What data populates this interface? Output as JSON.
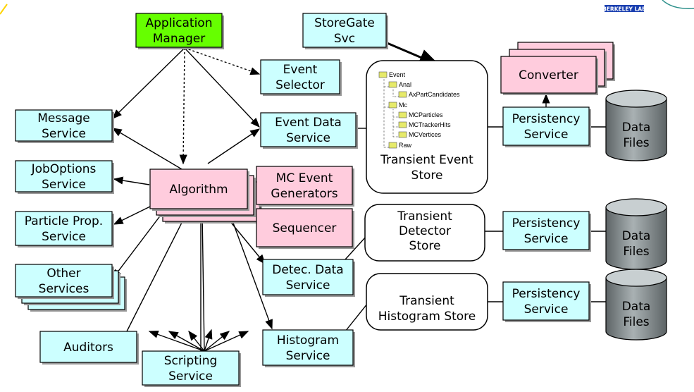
{
  "logo": {
    "text": "BERKELEY LAB",
    "color": "#1a3fb0"
  },
  "colors": {
    "service": "#ccffff",
    "component": "#ffccdd",
    "manager": "#66ff00",
    "datafile": "#8a9294",
    "shadow": "#999999"
  },
  "nodes": {
    "app_manager": [
      "Application",
      "Manager"
    ],
    "storegate": [
      "StoreGate",
      "Svc"
    ],
    "event_selector": [
      "Event",
      "Selector"
    ],
    "message_service": [
      "Message",
      "Service"
    ],
    "event_data_service": [
      "Event Data",
      "Service"
    ],
    "joboptions_service": [
      "JobOptions",
      "Service"
    ],
    "algorithm": [
      "Algorithm"
    ],
    "mc_event_generators": [
      "MC Event",
      "Generators"
    ],
    "sequencer": [
      "Sequencer"
    ],
    "particle_prop_service": [
      "Particle Prop.",
      "Service"
    ],
    "other_services": [
      "Other",
      "Services"
    ],
    "detec_data_service": [
      "Detec. Data",
      "Service"
    ],
    "auditors": [
      "Auditors"
    ],
    "scripting_service": [
      "Scripting",
      "Service"
    ],
    "histogram_service": [
      "Histogram",
      "Service"
    ],
    "converter": [
      "Converter"
    ],
    "persistency_1": [
      "Persistency",
      "Service"
    ],
    "persistency_2": [
      "Persistency",
      "Service"
    ],
    "persistency_3": [
      "Persistency",
      "Service"
    ],
    "data_files_1": [
      "Data",
      "Files"
    ],
    "data_files_2": [
      "Data",
      "Files"
    ],
    "data_files_3": [
      "Data",
      "Files"
    ],
    "transient_event_store": [
      "Transient Event",
      "Store"
    ],
    "transient_detector_store": [
      "Transient",
      "Detector",
      "Store"
    ],
    "transient_histogram_store": [
      "Transient",
      "Histogram Store"
    ]
  },
  "event_tree": [
    "Event",
    "Anal",
    "AxPartCandidates",
    "Mc",
    "MCParticles",
    "MCTrackerHits",
    "MCVertices",
    "Raw"
  ]
}
